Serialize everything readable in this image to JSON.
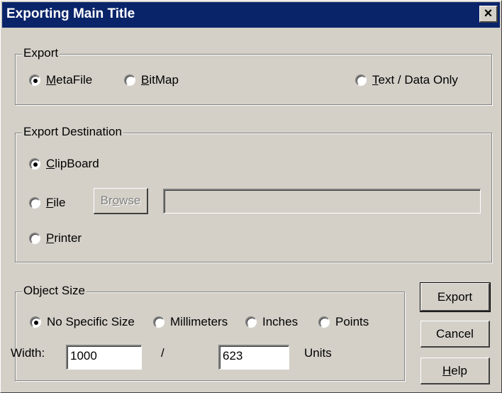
{
  "window": {
    "title": "Exporting Main Title",
    "close_glyph": "×"
  },
  "export_group": {
    "legend": "Export",
    "metafile": {
      "prefix": "",
      "underline": "M",
      "rest": "etaFile",
      "checked": true
    },
    "bitmap": {
      "prefix": "",
      "underline": "B",
      "rest": "itMap",
      "checked": false
    },
    "text_data": {
      "prefix": "",
      "underline": "T",
      "rest": "ext / Data Only",
      "checked": false
    }
  },
  "destination_group": {
    "legend": "Export Destination",
    "clipboard": {
      "prefix": "",
      "underline": "C",
      "rest": "lipBoard",
      "checked": true
    },
    "file": {
      "prefix": "",
      "underline": "F",
      "rest": "ile",
      "checked": false
    },
    "browse": {
      "prefix": "Br",
      "underline": "o",
      "rest": "wse",
      "enabled": false
    },
    "file_path": "",
    "printer": {
      "prefix": "",
      "underline": "P",
      "rest": "rinter",
      "checked": false
    }
  },
  "size_group": {
    "legend": "Object Size",
    "options": [
      "No Specific Size",
      "Millimeters",
      "Inches",
      "Points"
    ],
    "selected": "No Specific Size",
    "width_label": "Width:",
    "width_value": "1000",
    "separator": "/",
    "height_value": "623",
    "units_label": "Units"
  },
  "buttons": {
    "export": "Export",
    "cancel": "Cancel",
    "help": {
      "prefix": "",
      "underline": "H",
      "rest": "elp"
    }
  },
  "colors": {
    "titlebar": "#0a246a",
    "face": "#d4d0c8"
  }
}
